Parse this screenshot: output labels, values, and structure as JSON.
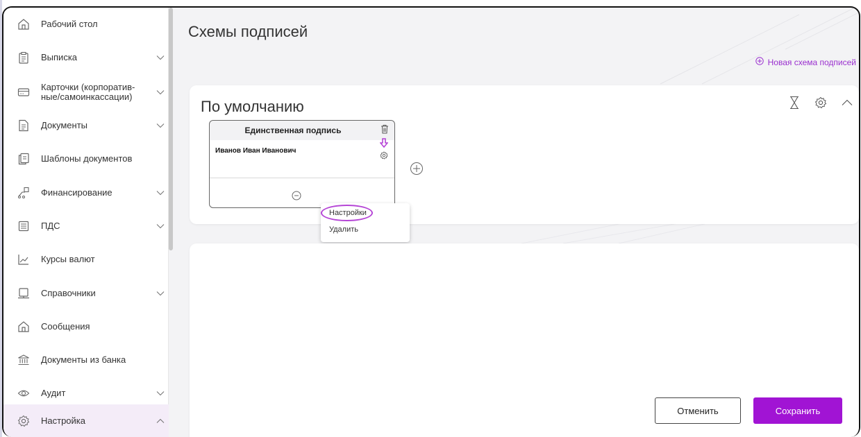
{
  "sidebar": {
    "items": [
      {
        "label": "Рабочий стол",
        "icon": "home-icon",
        "chevron": false
      },
      {
        "label": "Выписка",
        "icon": "clipboard-icon",
        "chevron": true
      },
      {
        "label": "Карточки (корпоратив-\nные/самоинкассации)",
        "icon": "card-icon",
        "chevron": true
      },
      {
        "label": "Документы",
        "icon": "document-icon",
        "chevron": true
      },
      {
        "label": "Шаблоны документов",
        "icon": "templates-icon",
        "chevron": false
      },
      {
        "label": "Финансирование",
        "icon": "financing-icon",
        "chevron": true
      },
      {
        "label": "ПДС",
        "icon": "pds-icon",
        "chevron": true
      },
      {
        "label": "Курсы валют",
        "icon": "chart-icon",
        "chevron": false
      },
      {
        "label": "Справочники",
        "icon": "directory-icon",
        "chevron": true
      },
      {
        "label": "Сообщения",
        "icon": "home-icon",
        "chevron": false
      },
      {
        "label": "Документы из банка",
        "icon": "bank-icon",
        "chevron": false
      },
      {
        "label": "Аудит",
        "icon": "eye-icon",
        "chevron": true
      },
      {
        "label": "Настройка",
        "icon": "gear-icon",
        "chevron": true,
        "active": true
      }
    ]
  },
  "page": {
    "title": "Схемы подписей",
    "new_scheme_label": "Новая схема подписей"
  },
  "scheme_card": {
    "title": "По умолчанию",
    "signature": {
      "title": "Единственная подпись",
      "signer": "Иванов Иван Иванович"
    },
    "context_menu": {
      "settings": "Настройки",
      "delete": "Удалить"
    }
  },
  "actions": {
    "cancel": "Отменить",
    "save": "Сохранить"
  },
  "colors": {
    "accent": "#a114d4",
    "highlight": "#b545d6",
    "active_bg": "#f4ecf8"
  }
}
